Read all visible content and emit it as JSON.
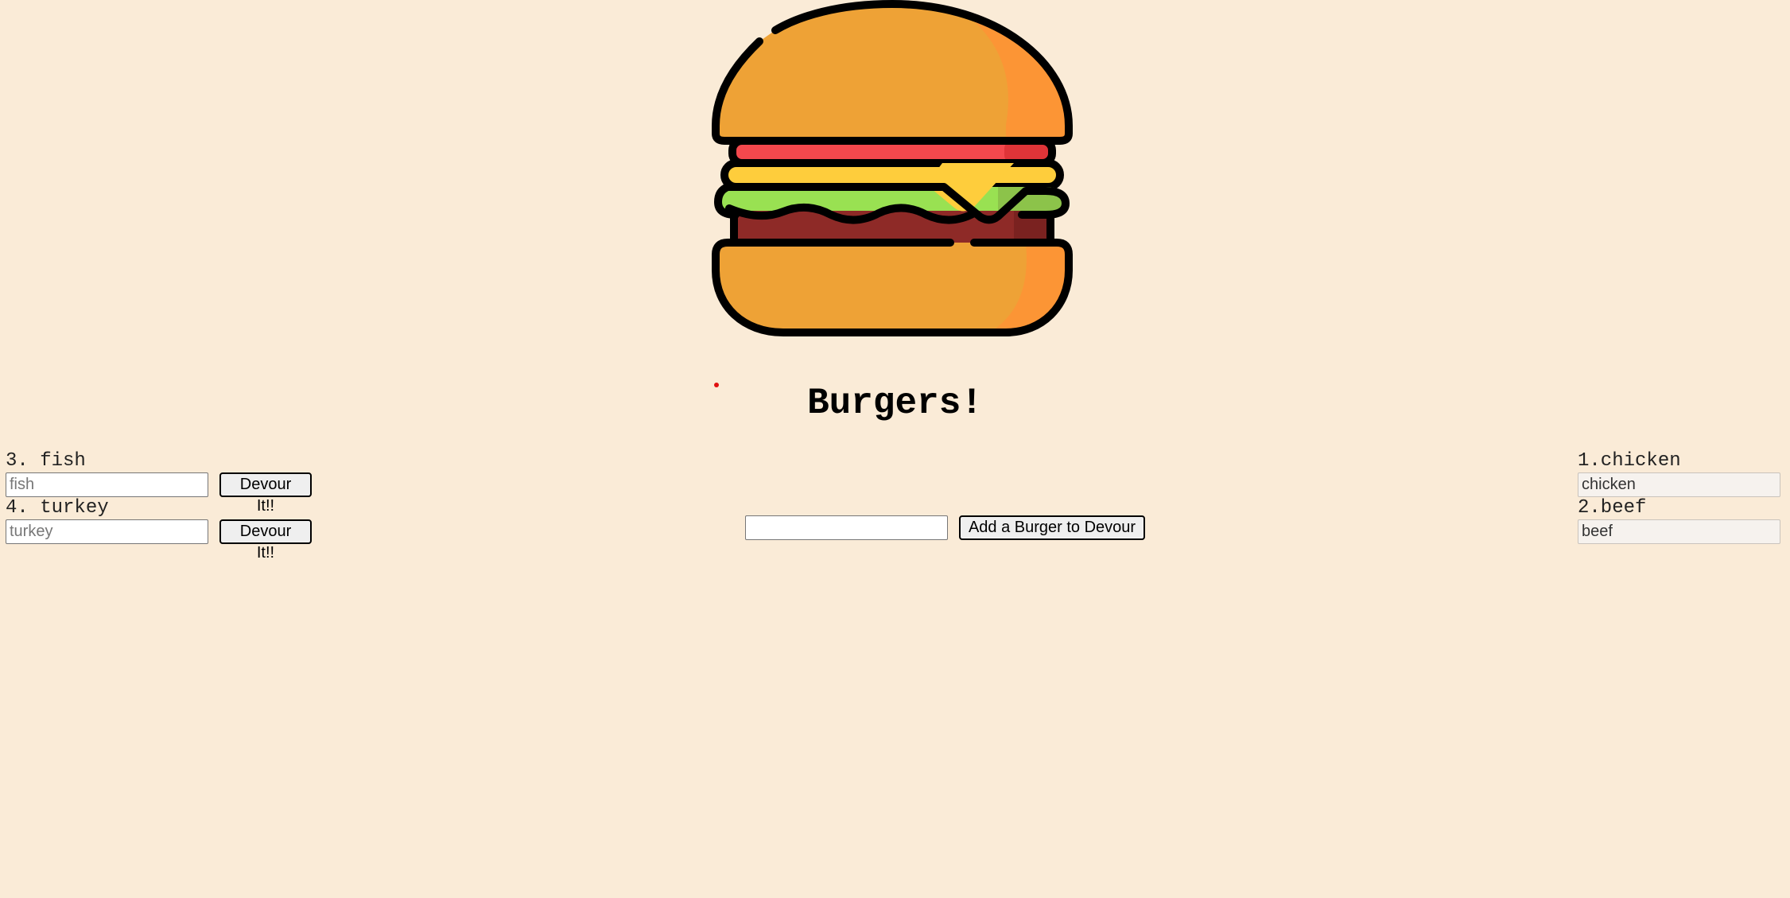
{
  "header": {
    "logo_icon": "hamburger-icon",
    "title": "Burgers!"
  },
  "colors": {
    "background": "#faebd7",
    "bun": "#eea236",
    "bun_shade": "#fc9535",
    "tomato": "#f4484d",
    "cheese": "#fecd3c",
    "lettuce": "#99e152",
    "patty": "#8e2a27",
    "outline": "#000000",
    "accent_dot": "#e01010"
  },
  "uneaten": {
    "items": [
      {
        "label": "3. fish",
        "placeholder": "fish",
        "button": "Devour It!!"
      },
      {
        "label": "4. turkey",
        "placeholder": "turkey",
        "button": "Devour It!!"
      }
    ]
  },
  "add_form": {
    "input_value": "",
    "button": "Add a Burger to Devour"
  },
  "devoured": {
    "items": [
      {
        "label": "1.chicken",
        "value": "chicken"
      },
      {
        "label": "2.beef",
        "value": "beef"
      }
    ]
  }
}
